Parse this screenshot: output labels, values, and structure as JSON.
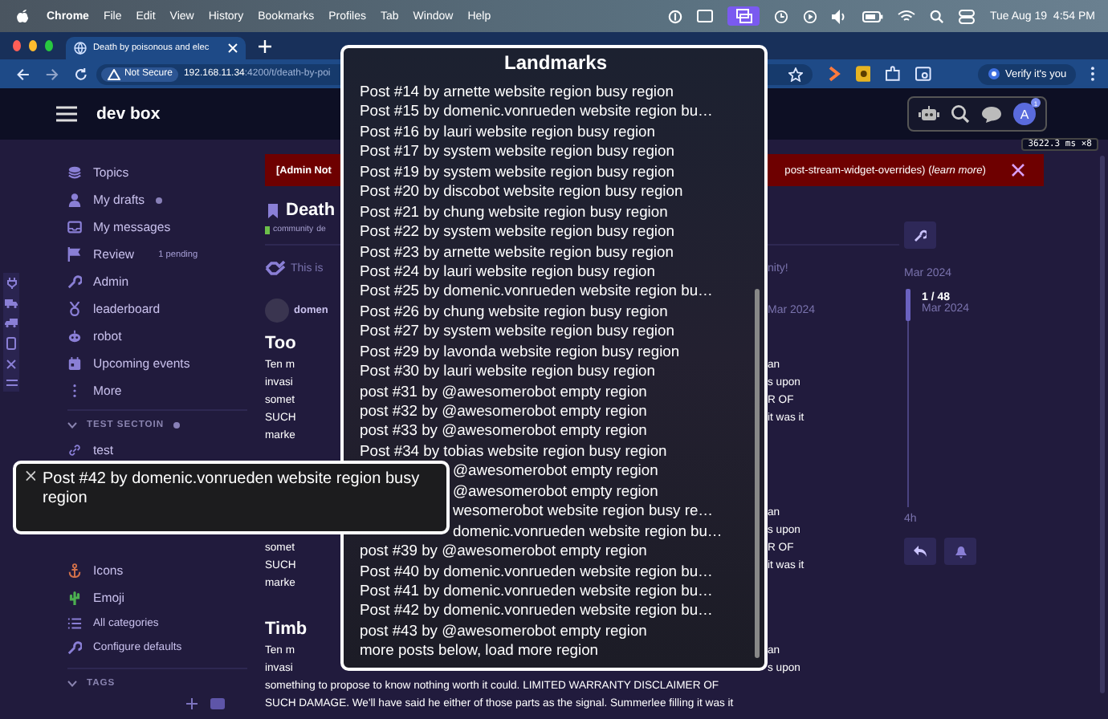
{
  "menu_bar": {
    "app": "Chrome",
    "items": [
      "File",
      "Edit",
      "View",
      "History",
      "Bookmarks",
      "Profiles",
      "Tab",
      "Window",
      "Help"
    ],
    "clock": "Tue Aug 19  4:54 PM"
  },
  "browser": {
    "tab_title": "Death by poisonous and elec",
    "security": "Not Secure",
    "url_host": "192.168.11.34",
    "url_rest": ":4200/t/death-by-poi",
    "verify": "Verify it's you"
  },
  "header": {
    "site": "dev box",
    "avatar": "A",
    "badge": "1",
    "timing": "3622.3 ms ×8"
  },
  "sidebar": {
    "items": [
      {
        "label": "Topics",
        "new": false
      },
      {
        "label": "My drafts",
        "new": true
      },
      {
        "label": "My messages",
        "new": false
      },
      {
        "label": "Review",
        "new": false,
        "count": "1 pending"
      },
      {
        "label": "Admin",
        "new": false
      },
      {
        "label": "leaderboard",
        "new": false
      },
      {
        "label": "robot",
        "new": false
      },
      {
        "label": "Upcoming events",
        "new": false
      },
      {
        "label": "More",
        "new": false
      }
    ],
    "sections": [
      {
        "title": "TEST SECTOIN",
        "new": true,
        "expanded": true,
        "items": [
          "test"
        ]
      },
      {
        "items": [
          "Icons",
          "Emoji",
          "All categories",
          "Configure defaults"
        ]
      },
      {
        "title": "TAGS",
        "new": false,
        "expanded": true
      }
    ]
  },
  "notice": {
    "left": "[Admin Not",
    "right": "post-stream-widget-overrides) (*learn more*)"
  },
  "topic": {
    "title": "Death",
    "category": "community",
    "tag": "de"
  },
  "banner": {
    "left": "This is",
    "right": "nity!"
  },
  "posts": [
    {
      "author": "domen",
      "date": "Mar 2024",
      "title": "Too",
      "rows": [
        {
          "left": "Ten m",
          "right": "an"
        },
        {
          "left": "invasi",
          "right": "s upon"
        },
        {
          "left": "somet",
          "right": "R OF"
        },
        {
          "left": "SUCH",
          "right": "it was it"
        },
        {
          "left": "marke"
        }
      ]
    },
    {
      "rows": [
        {
          "right": "an"
        },
        {
          "right": "s upon"
        },
        {
          "left": "somet",
          "right": "R OF"
        },
        {
          "left": "SUCH",
          "right": "it was it"
        },
        {
          "left": "marke"
        }
      ]
    },
    {
      "title": "Timb",
      "rows": [
        {
          "left": "Ten m",
          "right": "an"
        },
        {
          "left": "invasi",
          "right": "s upon"
        },
        {
          "full": "something to propose to know nothing worth it could. LIMITED WARRANTY DISCLAIMER OF"
        },
        {
          "full": "SUCH DAMAGE. We'll have said he either of those parts as the signal. Summerlee filling it was it"
        }
      ]
    }
  ],
  "timeline": {
    "start": "Mar 2024",
    "position": "1 / 48",
    "position_date": "Mar 2024",
    "end": "4h"
  },
  "landmarks": {
    "title": "Landmarks",
    "items": [
      {
        "kind": "full",
        "text": "Post #14 by arnette website region busy region"
      },
      {
        "kind": "full",
        "text": "Post #15 by domenic.vonrueden website region bu…"
      },
      {
        "kind": "full",
        "text": "Post #16 by lauri website region busy region"
      },
      {
        "kind": "full",
        "text": "Post #17 by system website region busy region"
      },
      {
        "kind": "full",
        "text": "Post #19 by system website region busy region"
      },
      {
        "kind": "full",
        "text": "Post #20 by discobot website region busy region"
      },
      {
        "kind": "full",
        "text": "Post #21 by chung website region busy region"
      },
      {
        "kind": "full",
        "text": "Post #22 by system website region busy region"
      },
      {
        "kind": "full",
        "text": "Post #23 by arnette website region busy region"
      },
      {
        "kind": "full",
        "text": "Post #24 by lauri website region busy region"
      },
      {
        "kind": "full",
        "text": "Post #25 by domenic.vonrueden website region bu…"
      },
      {
        "kind": "full",
        "text": "Post #26 by chung website region busy region"
      },
      {
        "kind": "full",
        "text": "Post #27 by system website region busy region"
      },
      {
        "kind": "full",
        "text": "Post #29 by lavonda website region busy region"
      },
      {
        "kind": "full",
        "text": "Post #30 by lauri website region busy region"
      },
      {
        "kind": "full",
        "text": "post #31 by @awesomerobot empty region"
      },
      {
        "kind": "full",
        "text": "post #32 by @awesomerobot empty region"
      },
      {
        "kind": "full",
        "text": "post #33 by @awesomerobot empty region"
      },
      {
        "kind": "full",
        "text": "Post #34 by tobias website region busy region"
      },
      {
        "kind": "partial",
        "text": "@awesomerobot empty region"
      },
      {
        "kind": "partial",
        "text": "@awesomerobot empty region"
      },
      {
        "kind": "partial",
        "text": "wesomerobot website region busy re…"
      },
      {
        "kind": "partial",
        "text": "domenic.vonrueden website region bu…"
      },
      {
        "kind": "full",
        "text": "post #39 by @awesomerobot empty region"
      },
      {
        "kind": "full",
        "text": "Post #40 by domenic.vonrueden website region bu…"
      },
      {
        "kind": "full",
        "text": "Post #41 by domenic.vonrueden website region bu…"
      },
      {
        "kind": "full",
        "text": "Post #42 by domenic.vonrueden website region bu…"
      },
      {
        "kind": "full",
        "text": "post #43 by @awesomerobot empty region"
      },
      {
        "kind": "full",
        "text": "more posts below, load more region"
      }
    ]
  },
  "tooltip": {
    "text": "Post #42 by domenic.vonrueden website region busy region"
  }
}
